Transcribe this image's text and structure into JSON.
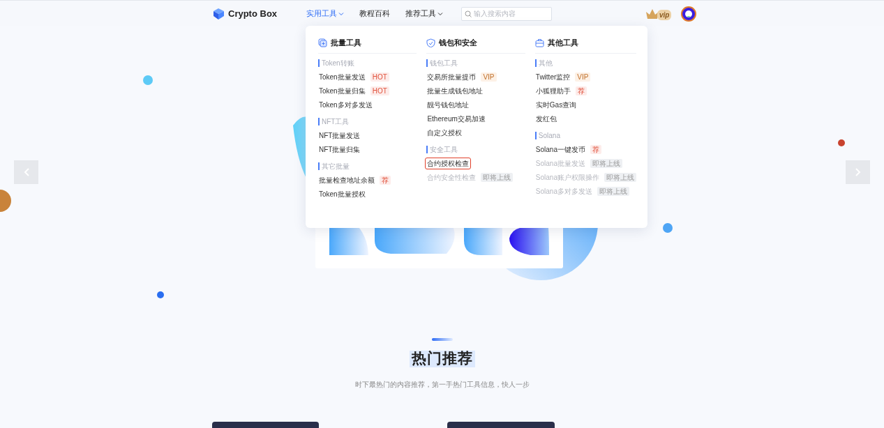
{
  "header": {
    "logo": "Crypto Box",
    "nav": [
      {
        "label": "实用工具",
        "selected": true,
        "dropdown": true
      },
      {
        "label": "教程百科",
        "selected": false,
        "dropdown": false
      },
      {
        "label": "推荐工具",
        "selected": false,
        "dropdown": true
      }
    ],
    "search": {
      "placeholder": "输入搜索内容"
    },
    "vip": "vip"
  },
  "menu": {
    "columns": [
      {
        "title": "批量工具",
        "groups": [
          {
            "label": "Token转账",
            "items": [
              {
                "label": "Token批量发送",
                "badge": {
                  "text": "HOT",
                  "kind": "hot"
                },
                "disabled": false,
                "highlighted": false
              },
              {
                "label": "Token批量归集",
                "badge": {
                  "text": "HOT",
                  "kind": "hot"
                },
                "disabled": false,
                "highlighted": false
              },
              {
                "label": "Token多对多发送",
                "disabled": false,
                "highlighted": false
              }
            ]
          },
          {
            "label": "NFT工具",
            "items": [
              {
                "label": "NFT批量发送",
                "disabled": false,
                "highlighted": false
              },
              {
                "label": "NFT批量归集",
                "disabled": false,
                "highlighted": false
              }
            ]
          },
          {
            "label": "其它批量",
            "items": [
              {
                "label": "批量检查地址余额",
                "badge": {
                  "text": "荐",
                  "kind": "hot"
                },
                "disabled": false,
                "highlighted": false
              },
              {
                "label": "Token批量授权",
                "disabled": false,
                "highlighted": false
              }
            ]
          }
        ]
      },
      {
        "title": "钱包和安全",
        "groups": [
          {
            "label": "钱包工具",
            "items": [
              {
                "label": "交易所批量提币",
                "badge": {
                  "text": "VIP",
                  "kind": "vip"
                },
                "disabled": false,
                "highlighted": false
              },
              {
                "label": "批量生成钱包地址",
                "disabled": false,
                "highlighted": false
              },
              {
                "label": "靓号钱包地址",
                "disabled": false,
                "highlighted": false
              },
              {
                "label": "Ethereum交易加速",
                "disabled": false,
                "highlighted": false
              },
              {
                "label": "自定义授权",
                "disabled": false,
                "highlighted": false
              }
            ]
          },
          {
            "label": "安全工具",
            "items": [
              {
                "label": "合约授权检查",
                "disabled": false,
                "highlighted": true
              },
              {
                "label": "合约安全性检查",
                "badge": {
                  "text": "即将上线",
                  "kind": "soon"
                },
                "disabled": true,
                "highlighted": false
              }
            ]
          }
        ]
      },
      {
        "title": "其他工具",
        "groups": [
          {
            "label": "其他",
            "items": [
              {
                "label": "Twitter监控",
                "badge": {
                  "text": "VIP",
                  "kind": "vip"
                },
                "disabled": false,
                "highlighted": false
              },
              {
                "label": "小狐狸助手",
                "badge": {
                  "text": "荐",
                  "kind": "hot"
                },
                "disabled": false,
                "highlighted": false
              },
              {
                "label": "实时Gas查询",
                "disabled": false,
                "highlighted": false
              },
              {
                "label": "发红包",
                "disabled": false,
                "highlighted": false
              }
            ]
          },
          {
            "label": "Solana",
            "items": [
              {
                "label": "Solana一键发币",
                "badge": {
                  "text": "荐",
                  "kind": "hot"
                },
                "disabled": false,
                "highlighted": false
              },
              {
                "label": "Solana批量发送",
                "badge": {
                  "text": "即将上线",
                  "kind": "soon"
                },
                "disabled": true,
                "highlighted": false
              },
              {
                "label": "Solana账户权限操作",
                "badge": {
                  "text": "即将上线",
                  "kind": "soon"
                },
                "disabled": true,
                "highlighted": false
              },
              {
                "label": "Solana多对多发送",
                "badge": {
                  "text": "即将上线",
                  "kind": "soon"
                },
                "disabled": true,
                "highlighted": false
              }
            ]
          }
        ]
      }
    ]
  },
  "section": {
    "title": "热门推荐",
    "subtitle": "时下最热门的内容推荐，第一手热门工具信息，快人一步"
  }
}
